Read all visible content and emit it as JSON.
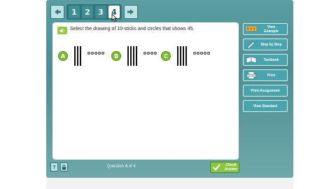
{
  "toolbar": {
    "back_icon": "arrow-left-icon",
    "forward_icon": "arrow-right-icon",
    "pages": [
      "1",
      "2",
      "3",
      "4"
    ],
    "active_page": "4"
  },
  "question": {
    "speaker_icon": "speaker-icon",
    "text": "Select the drawing of 10-sticks and circles that shows 45.",
    "choices": [
      {
        "letter": "A",
        "tens": 3,
        "ones": 5
      },
      {
        "letter": "B",
        "tens": 4,
        "ones": 4
      },
      {
        "letter": "C",
        "tens": 4,
        "ones": 5
      }
    ]
  },
  "footer": {
    "help_label": "?",
    "lock_icon": "lock-icon",
    "question_word": "Question",
    "current": "4",
    "of_word": "of",
    "total": "4",
    "check_answer_line1": "Check",
    "check_answer_line2": "Answer"
  },
  "sidebar": {
    "items": [
      {
        "label1": "View",
        "label2": "Example",
        "icon": "example-icon"
      },
      {
        "label1": "Step by Step",
        "label2": "",
        "icon": "pencil-icon"
      },
      {
        "label1": "Textbook",
        "label2": "",
        "icon": "book-icon"
      },
      {
        "label1": "Print",
        "label2": "",
        "icon": "printer-icon"
      },
      {
        "label1": "Print Assignment",
        "label2": "",
        "icon": ""
      },
      {
        "label1": "View Standard",
        "label2": "",
        "icon": ""
      }
    ]
  },
  "colors": {
    "frame": "#4c8e93",
    "accent_green": "#7cbc2e",
    "sidebar_button": "#49a4ad"
  }
}
